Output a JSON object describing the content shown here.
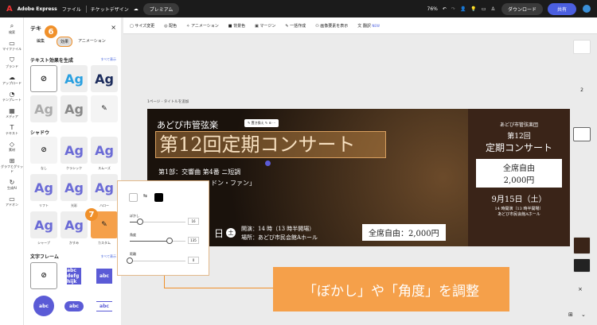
{
  "topbar": {
    "app": "Adobe Express",
    "file": "ファイル",
    "doc": "チケットデザイン",
    "premium": "プレミアム",
    "zoom": "76%",
    "download": "ダウンロード",
    "share": "共有"
  },
  "toolbar": [
    "サイズ変更",
    "配色",
    "アニメーション",
    "背景色",
    "マージン",
    "一括作成",
    "画像要素を表示",
    "翻訳"
  ],
  "toolbar_new": "NEW",
  "rail": [
    "検索",
    "マイファイル",
    "ブランド",
    "アップロード",
    "テンプレート",
    "メディア",
    "テキスト",
    "素材",
    "グラフとグリッド",
    "生成AI",
    "アドオン"
  ],
  "panel": {
    "title": "テキ",
    "tabs": [
      "編集",
      "効果",
      "アニメーション"
    ],
    "gen_title": "テキスト効果を生成",
    "see_all": "すべて表示",
    "shadow_title": "シャドウ",
    "shadows": [
      "なし",
      "クラシック",
      "スムーズ",
      "リフト",
      "光彩",
      "ハロー",
      "シャープ",
      "かすみ",
      "カスタム"
    ],
    "frame_title": "文字フレーム",
    "sample": "Ag",
    "frame_sample": "abc",
    "frame_multi": "abc defg hijk"
  },
  "badges": {
    "step6": "6",
    "step7": "7"
  },
  "popup": {
    "blur_label": "ぼかし",
    "blur": "16",
    "angle_label": "角度",
    "angle": "135",
    "distance_label": "距離",
    "distance": "0",
    "blur_pct": 0.2,
    "angle_pct": 0.75,
    "distance_pct": 0
  },
  "canvas": {
    "breadcrumb": "1ページ - タイトルを追加",
    "org": "あどび市管弦楽",
    "title": "第12回定期コンサート",
    "mini_toolbar": "置き換え",
    "line1": "第1部：交響曲 第4番 ニ短調",
    "line2": "ドン・ファン」",
    "date_day": "日",
    "weekday": "土",
    "open": "開演：14 時（13 時半開場）",
    "venue": "場所：あどび市民会館Aホール",
    "price": "全席自由：2,000円"
  },
  "right": {
    "org": "あどび市管弦楽団",
    "num": "第12回",
    "title": "定期コンサート",
    "free": "全席自由",
    "price": "2,000円",
    "date": "9月15日（土）",
    "time": "14 時開演（13 時半開場）",
    "venue": "あどび市民会館Aホール"
  },
  "callout": "「ぼかし」や「角度」を調整",
  "page_num": "2"
}
